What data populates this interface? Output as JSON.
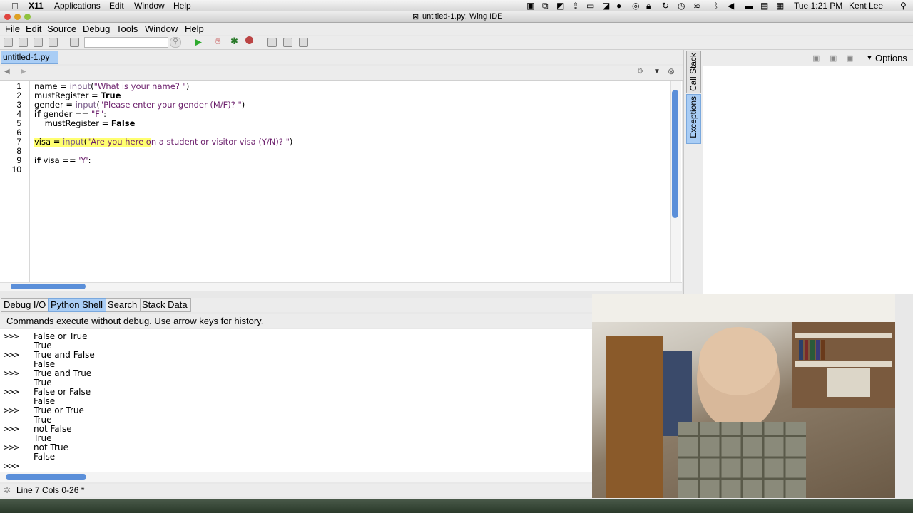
{
  "mac_menubar": {
    "app_name": "X11",
    "items": [
      "Applications",
      "Edit",
      "Window",
      "Help"
    ],
    "clock": "Tue 1:21 PM",
    "user": "Kent Lee"
  },
  "window": {
    "title": "untitled-1.py: Wing IDE"
  },
  "app_menu": [
    "File",
    "Edit",
    "Source",
    "Debug",
    "Tools",
    "Window",
    "Help"
  ],
  "editor": {
    "tab_label": "untitled-1.py",
    "line_numbers": [
      "1",
      "2",
      "3",
      "4",
      "5",
      "6",
      "7",
      "8",
      "9",
      "10"
    ],
    "lines": [
      {
        "n": "1",
        "parts": [
          [
            "name = ",
            ""
          ],
          [
            "input",
            "bi"
          ],
          [
            "(",
            ""
          ],
          [
            "\"What is your name? \"",
            "str"
          ],
          [
            ")",
            ""
          ]
        ]
      },
      {
        "n": "2",
        "parts": [
          [
            "mustRegister = ",
            ""
          ],
          [
            "True",
            "kw"
          ]
        ]
      },
      {
        "n": "3",
        "parts": [
          [
            "gender = ",
            ""
          ],
          [
            "input",
            "bi"
          ],
          [
            "(",
            ""
          ],
          [
            "\"Please enter your gender (M/F)? \"",
            "str"
          ],
          [
            ")",
            ""
          ]
        ]
      },
      {
        "n": "4",
        "parts": [
          [
            "if",
            "kw"
          ],
          [
            " gender == ",
            ""
          ],
          [
            "\"F\"",
            "str"
          ],
          [
            ":",
            ""
          ]
        ]
      },
      {
        "n": "5",
        "parts": [
          [
            "    mustRegister = ",
            ""
          ],
          [
            "False",
            "kw"
          ]
        ]
      },
      {
        "n": "6",
        "parts": []
      },
      {
        "n": "7",
        "parts": [
          [
            "visa = ",
            ""
          ],
          [
            "input",
            "bi"
          ],
          [
            "(",
            ""
          ],
          [
            "\"Are you here on a student or visitor visa (Y/N)? \"",
            "str"
          ],
          [
            ")",
            ""
          ]
        ]
      },
      {
        "n": "8",
        "parts": []
      },
      {
        "n": "9",
        "parts": [
          [
            "if",
            "kw"
          ],
          [
            " visa == ",
            ""
          ],
          [
            "'Y'",
            "str"
          ],
          [
            ":",
            ""
          ]
        ]
      },
      {
        "n": "10",
        "parts": []
      }
    ]
  },
  "right_panel": {
    "vertical_tabs": [
      "Call Stack",
      "Exceptions"
    ],
    "options_label": "Options"
  },
  "bottom_tabs": [
    {
      "label": "Debug I/O",
      "active": false
    },
    {
      "label": "Python Shell",
      "active": true
    },
    {
      "label": "Search",
      "active": false
    },
    {
      "label": "Stack Data",
      "active": false
    }
  ],
  "shell": {
    "info": "Commands execute without debug.  Use arrow keys for history.",
    "prompt": ">>>",
    "lines": [
      {
        "prompt": true,
        "text": "False or True"
      },
      {
        "prompt": false,
        "text": "True"
      },
      {
        "prompt": true,
        "text": "True and False"
      },
      {
        "prompt": false,
        "text": "False"
      },
      {
        "prompt": true,
        "text": "True and True"
      },
      {
        "prompt": false,
        "text": "True"
      },
      {
        "prompt": true,
        "text": "False or False"
      },
      {
        "prompt": false,
        "text": "False"
      },
      {
        "prompt": true,
        "text": "True or True"
      },
      {
        "prompt": false,
        "text": "True"
      },
      {
        "prompt": true,
        "text": "not False"
      },
      {
        "prompt": false,
        "text": "True"
      },
      {
        "prompt": true,
        "text": "not True"
      },
      {
        "prompt": false,
        "text": "False"
      },
      {
        "prompt": true,
        "text": ""
      }
    ]
  },
  "status": {
    "text": "Line 7 Cols 0-26 *"
  },
  "colors": {
    "accent": "#a9cdf5",
    "scroll_thumb": "#5b8fd9",
    "highlight": "#ffff70",
    "string": "#6b1e6b"
  }
}
